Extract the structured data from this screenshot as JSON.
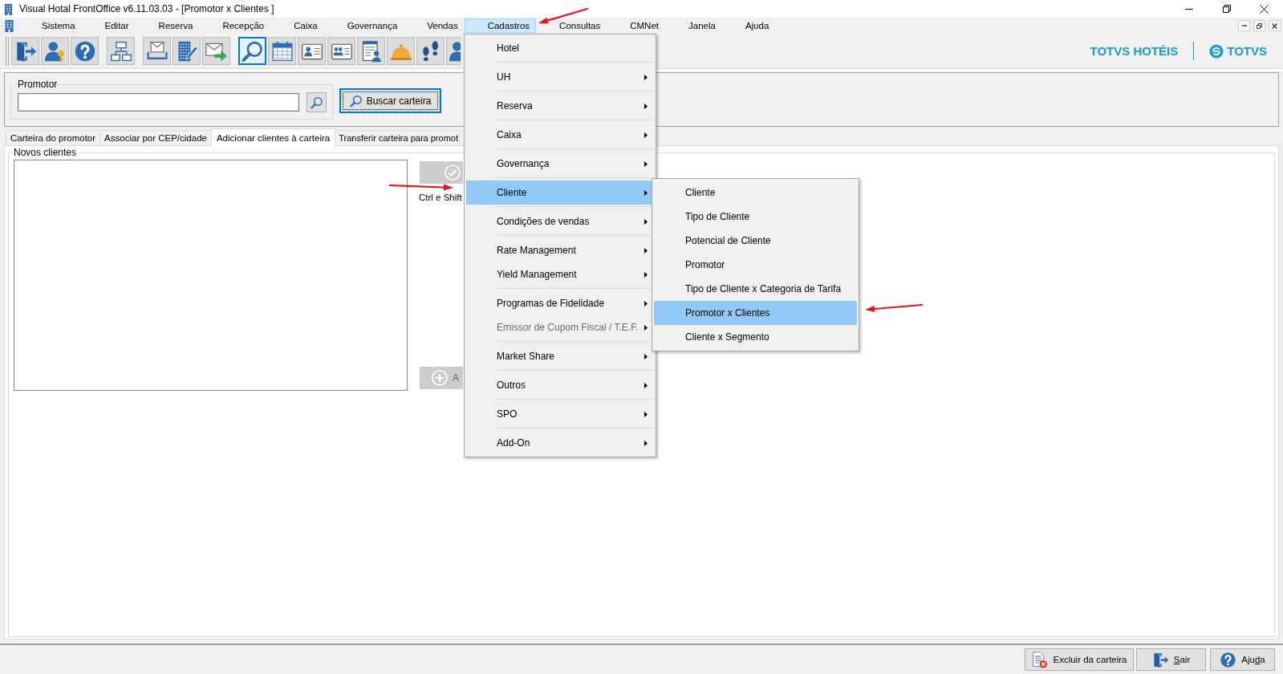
{
  "window": {
    "title": "Visual Hotal FrontOffice v6.11.03.03 - [Promotor x Clientes ]"
  },
  "menubar": {
    "items": [
      {
        "label": "Sistema",
        "selected": false
      },
      {
        "label": "Editar",
        "selected": false
      },
      {
        "label": "Reserva",
        "selected": false
      },
      {
        "label": "Recepção",
        "selected": false
      },
      {
        "label": "Caixa",
        "selected": false
      },
      {
        "label": "Governança",
        "selected": false
      },
      {
        "label": "Vendas",
        "selected": false
      },
      {
        "label": "Cadastros",
        "selected": true
      },
      {
        "label": "Consultas",
        "selected": false
      },
      {
        "label": "CMNet",
        "selected": false
      },
      {
        "label": "Janela",
        "selected": false
      },
      {
        "label": "Ajuda",
        "selected": false
      }
    ]
  },
  "toolbar": {
    "groups": [
      {
        "buttons": [
          {
            "selected": false
          },
          {
            "selected": false
          },
          {
            "selected": false
          }
        ]
      },
      {
        "buttons": [
          {
            "selected": false
          }
        ]
      },
      {
        "buttons": [
          {
            "selected": false
          },
          {
            "selected": false
          },
          {
            "selected": false
          }
        ]
      },
      {
        "buttons": [
          {
            "selected": true
          },
          {
            "selected": false
          },
          {
            "selected": false
          },
          {
            "selected": false
          },
          {
            "selected": false
          },
          {
            "selected": false
          },
          {
            "selected": false
          },
          {
            "selected": false
          }
        ]
      }
    ]
  },
  "branding": {
    "product": "TOTVS HOTÉIS",
    "company": "TOTVS"
  },
  "promotor": {
    "label": "Promotor",
    "search_button": {
      "label": "Buscar carteira",
      "focused": true
    }
  },
  "tabs": [
    {
      "label": "Carteira do promotor",
      "selected": false
    },
    {
      "label": "Associar por CEP/cidade",
      "selected": false
    },
    {
      "label": "Adicionar clientes à carteira",
      "selected": true
    },
    {
      "label": "Transferir carteira para promot",
      "selected": false
    }
  ],
  "new_clients": {
    "label": "Novos clientes",
    "confirm_button": {
      "disabled": true
    },
    "shortcut_hint": "Ctrl e Shift",
    "add_button": {
      "label": "A",
      "disabled": true
    }
  },
  "dropdown": {
    "sections": [
      {
        "items": [
          {
            "label": "Hotel",
            "submenu": false,
            "disabled": false,
            "selected": false
          }
        ]
      },
      {
        "items": [
          {
            "label": "UH",
            "submenu": true,
            "disabled": false,
            "selected": false
          }
        ]
      },
      {
        "items": [
          {
            "label": "Reserva",
            "submenu": true,
            "disabled": false,
            "selected": false
          }
        ]
      },
      {
        "items": [
          {
            "label": "Caixa",
            "submenu": true,
            "disabled": false,
            "selected": false
          }
        ]
      },
      {
        "items": [
          {
            "label": "Governança",
            "submenu": true,
            "disabled": false,
            "selected": false
          }
        ]
      },
      {
        "items": [
          {
            "label": "Cliente",
            "submenu": true,
            "disabled": false,
            "selected": true
          }
        ]
      },
      {
        "items": [
          {
            "label": "Condições de vendas",
            "submenu": true,
            "disabled": false,
            "selected": false
          }
        ]
      },
      {
        "items": [
          {
            "label": "Rate Management",
            "submenu": true,
            "disabled": false,
            "selected": false
          },
          {
            "label": "Yield Management",
            "submenu": true,
            "disabled": false,
            "selected": false
          }
        ]
      },
      {
        "items": [
          {
            "label": "Programas de Fidelidade",
            "submenu": true,
            "disabled": false,
            "selected": false
          },
          {
            "label": "Emissor de Cupom Fiscal / T.E.F.",
            "submenu": true,
            "disabled": true,
            "selected": false
          }
        ]
      },
      {
        "items": [
          {
            "label": "Market Share",
            "submenu": true,
            "disabled": false,
            "selected": false
          }
        ]
      },
      {
        "items": [
          {
            "label": "Outros",
            "submenu": true,
            "disabled": false,
            "selected": false
          }
        ]
      },
      {
        "items": [
          {
            "label": "SPO",
            "submenu": true,
            "disabled": false,
            "selected": false
          }
        ]
      },
      {
        "items": [
          {
            "label": "Add-On",
            "submenu": true,
            "disabled": false,
            "selected": false
          }
        ]
      }
    ]
  },
  "submenu": {
    "items": [
      {
        "label": "Cliente",
        "selected": false
      },
      {
        "label": "Tipo de Cliente",
        "selected": false
      },
      {
        "label": "Potencial de Cliente",
        "selected": false
      },
      {
        "label": "Promotor",
        "selected": false
      },
      {
        "label": "Tipo de Cliente x Categoria de Tarifa",
        "selected": false
      },
      {
        "label": "Promotor x Clientes",
        "selected": true
      },
      {
        "label": "Cliente x Segmento",
        "selected": false
      }
    ]
  },
  "footer": {
    "buttons": [
      {
        "label_start": "Excluir da carteira"
      },
      {
        "access_key": "S",
        "label_end": "air"
      },
      {
        "label_start": "Aju",
        "access_key": "d",
        "label_end": "a"
      }
    ]
  }
}
